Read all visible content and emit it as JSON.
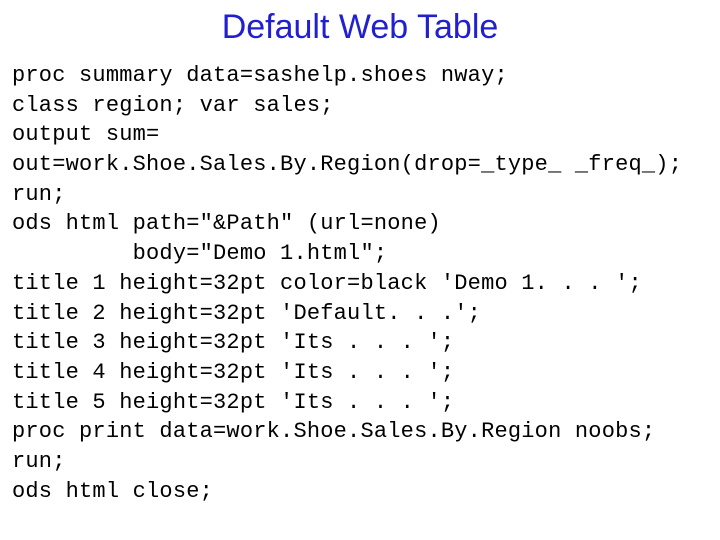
{
  "title": "Default Web Table",
  "code_lines": [
    "proc summary data=sashelp.shoes nway;",
    "class region; var sales;",
    "output sum=",
    "out=work.Shoe.Sales.By.Region(drop=_type_ _freq_);",
    "run;",
    "ods html path=\"&Path\" (url=none)",
    "         body=\"Demo 1.html\";",
    "title 1 height=32pt color=black 'Demo 1. . . ';",
    "title 2 height=32pt 'Default. . .';",
    "title 3 height=32pt 'Its . . . ';",
    "title 4 height=32pt 'Its . . . ';",
    "title 5 height=32pt 'Its . . . ';",
    "proc print data=work.Shoe.Sales.By.Region noobs;",
    "run;",
    "ods html close;"
  ]
}
